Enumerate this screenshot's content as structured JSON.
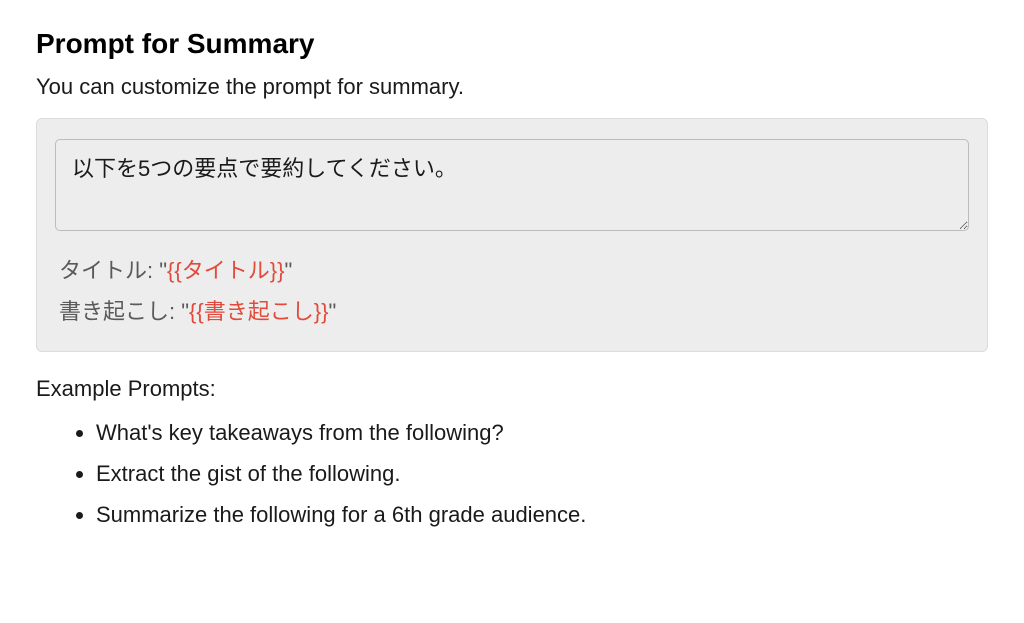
{
  "section": {
    "title": "Prompt for Summary",
    "description": "You can customize the prompt for summary."
  },
  "prompt": {
    "value": "以下を5つの要点で要約してください。",
    "templates": [
      {
        "label": "タイトル: ",
        "quote_open": "\"",
        "placeholder": "{{タイトル}}",
        "quote_close": "\""
      },
      {
        "label": "書き起こし: ",
        "quote_open": "\"",
        "placeholder": "{{書き起こし}}",
        "quote_close": "\""
      }
    ]
  },
  "examples": {
    "heading": "Example Prompts:",
    "items": [
      "What's key takeaways from the following?",
      "Extract the gist of the following.",
      "Summarize the following for a 6th grade audience."
    ]
  },
  "colors": {
    "placeholder": "#e24a3b",
    "panel_bg": "#ededed"
  }
}
